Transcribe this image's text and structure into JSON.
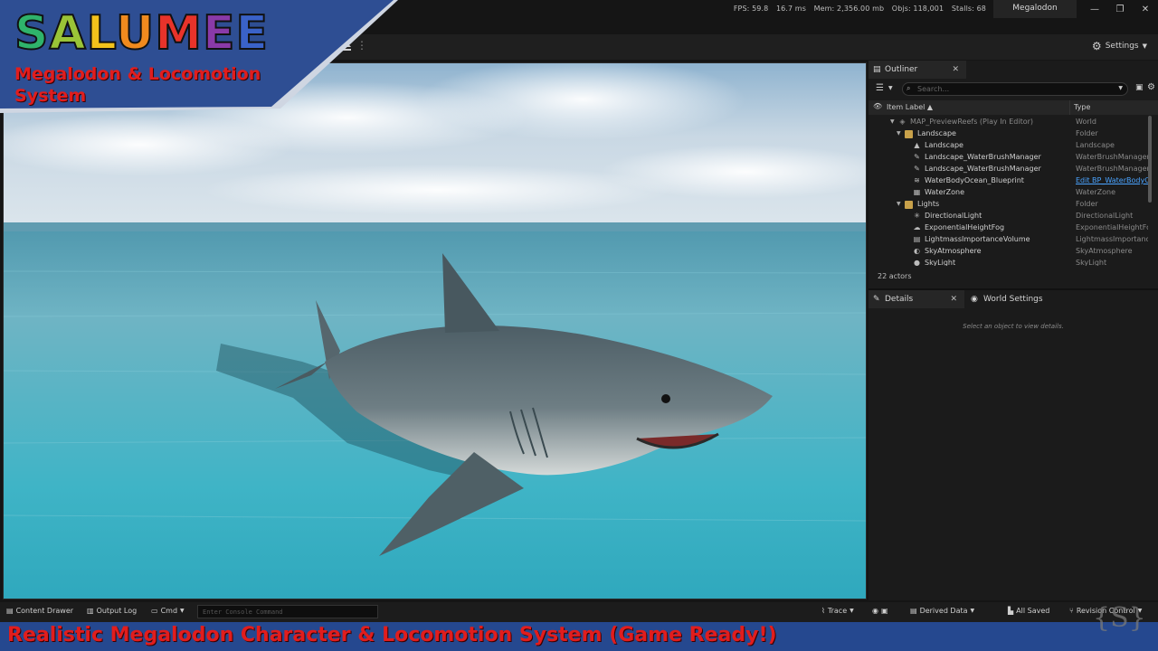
{
  "titlebar": {
    "fps": "FPS: 59.8",
    "frame_ms": "16.7 ms",
    "mem": "Mem: 2,356.00 mb",
    "objs": "Objs: 118,001",
    "stalls": "Stalls: 68",
    "project_name": "Megalodon",
    "minimize": "—",
    "restore": "❐",
    "close": "✕"
  },
  "toolbar": {
    "settings_label": "Settings",
    "more": "⋮"
  },
  "outliner": {
    "tab_label": "Outliner",
    "search_placeholder": "Search...",
    "col_item_label": "Item Label",
    "col_type": "Type",
    "rows": [
      {
        "label": "MAP_PreviewReefs (Play In Editor)",
        "type": "World"
      },
      {
        "label": "Landscape",
        "type": "Folder"
      },
      {
        "label": "Landscape",
        "type": "Landscape"
      },
      {
        "label": "Landscape_WaterBrushManager",
        "type": "WaterBrushManager"
      },
      {
        "label": "Landscape_WaterBrushManager",
        "type": "WaterBrushManager"
      },
      {
        "label": "WaterBodyOcean_Blueprint",
        "type": "Edit BP_WaterBodyOcean"
      },
      {
        "label": "WaterZone",
        "type": "WaterZone"
      },
      {
        "label": "Lights",
        "type": "Folder"
      },
      {
        "label": "DirectionalLight",
        "type": "DirectionalLight"
      },
      {
        "label": "ExponentialHeightFog",
        "type": "ExponentialHeightFog"
      },
      {
        "label": "LightmassImportanceVolume",
        "type": "LightmassImportanceVolume"
      },
      {
        "label": "SkyAtmosphere",
        "type": "SkyAtmosphere"
      },
      {
        "label": "SkyLight",
        "type": "SkyLight"
      }
    ],
    "actors_count": "22 actors"
  },
  "details": {
    "tab_label": "Details",
    "world_settings_label": "World Settings",
    "hint": "Select an object to view details."
  },
  "statusbar": {
    "content_drawer": "Content Drawer",
    "output_log": "Output Log",
    "cmd": "Cmd",
    "console_placeholder": "Enter Console Command",
    "trace": "Trace",
    "derived_data": "Derived Data",
    "all_saved": "All Saved",
    "revision_control": "Revision Control"
  },
  "overlay": {
    "brand_letters": [
      "S",
      "A",
      "L",
      "U",
      "M",
      "E",
      "E"
    ],
    "brand_colors": [
      "#2fb36b",
      "#9ac437",
      "#f3c21b",
      "#f08a1e",
      "#e8332a",
      "#8a3aa8",
      "#3a62c8"
    ],
    "brand_subtitle": "Megalodon & Locomotion System",
    "banner_text": "Realistic Megalodon Character & Locomotion System (Game Ready!)",
    "banner_color": "#25488f",
    "accent_red": "#e11d1d"
  }
}
